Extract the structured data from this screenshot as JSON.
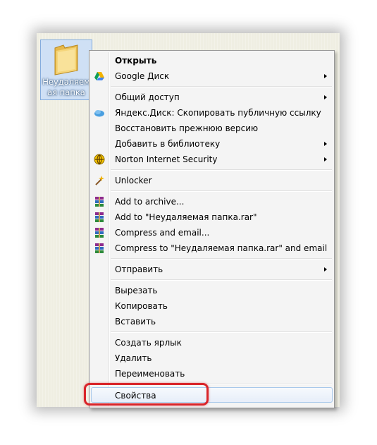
{
  "desktop": {
    "folder_label": "Неудаляемая папка"
  },
  "context_menu": {
    "items": [
      {
        "label": "Открыть",
        "bold": true,
        "icon": "none"
      },
      {
        "label": "Google Диск",
        "submenu": true,
        "icon": "google-drive-icon"
      },
      {
        "label": "Общий доступ",
        "submenu": true,
        "icon": "none"
      },
      {
        "label": "Яндекс.Диск: Скопировать публичную ссылку",
        "icon": "yandex-disk-icon"
      },
      {
        "label": "Восстановить прежнюю версию",
        "icon": "none"
      },
      {
        "label": "Добавить в библиотеку",
        "submenu": true,
        "icon": "none"
      },
      {
        "label": "Norton Internet Security",
        "submenu": true,
        "icon": "norton-icon"
      },
      {
        "label": "Unlocker",
        "icon": "unlocker-wand-icon"
      },
      {
        "label": "Add to archive...",
        "icon": "winrar-icon"
      },
      {
        "label": "Add to \"Неудаляемая папка.rar\"",
        "icon": "winrar-icon"
      },
      {
        "label": "Compress and email...",
        "icon": "winrar-icon"
      },
      {
        "label": "Compress to \"Неудаляемая папка.rar\" and email",
        "icon": "winrar-icon"
      },
      {
        "label": "Отправить",
        "submenu": true,
        "icon": "none"
      },
      {
        "label": "Вырезать",
        "icon": "none"
      },
      {
        "label": "Копировать",
        "icon": "none"
      },
      {
        "label": "Вставить",
        "icon": "none"
      },
      {
        "label": "Создать ярлык",
        "icon": "none"
      },
      {
        "label": "Удалить",
        "icon": "none"
      },
      {
        "label": "Переименовать",
        "icon": "none"
      },
      {
        "label": "Свойства",
        "icon": "none",
        "highlighted": true
      }
    ]
  },
  "colors": {
    "highlight_outline": "#d9252a",
    "hover_border": "#a8c8ea"
  }
}
